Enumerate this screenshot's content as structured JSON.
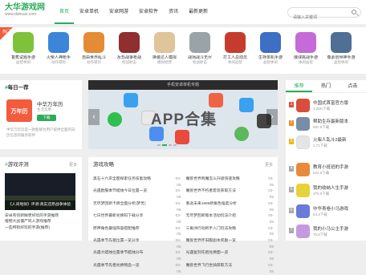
{
  "header": {
    "logo_title": "大华游戏网",
    "logo_url": "www.dahuax.com",
    "search_placeholder": "请输入关键词"
  },
  "nav": [
    "首页",
    "安卓单机",
    "安卓网游",
    "安卓软件",
    "资讯",
    "最新更新"
  ],
  "hot_tag": "热门",
  "apps": [
    {
      "name": "香蕉试题手游",
      "dl": "益智休闲",
      "color": "#7ec23a"
    },
    {
      "name": "火柴人神枪手",
      "dl": "动作冒险",
      "color": "#3b86d8"
    },
    {
      "name": "自由世界乱斗",
      "dl": "动作冒险",
      "color": "#e58b34"
    },
    {
      "name": "反恐战争枪战",
      "dl": "枪战射击",
      "color": "#8f2f2f"
    },
    {
      "name": "换装达人模拟",
      "dl": "模拟经营",
      "color": "#e0c49a"
    },
    {
      "name": "战场战斗无尽",
      "dl": "枪战射击",
      "color": "#9aa3a8"
    },
    {
      "name": "打工人总动员",
      "dl": "休闲益智",
      "color": "#c53c2d"
    },
    {
      "name": "生存单机手游",
      "dl": "益智休闲",
      "color": "#3d6fc4"
    },
    {
      "name": "爆球挑战手游",
      "dl": "休闲益智",
      "color": "#c46bd8"
    },
    {
      "name": "像素创世神手游",
      "dl": "益智休闲",
      "color": "#4f6f95"
    }
  ],
  "today": {
    "title_accent": "#",
    "title": "每日一荐",
    "app_name": "中华万年历",
    "app_char": "万年历",
    "category": "生活实用",
    "button": "下载",
    "desc": "中华万年历是一款能够为用户提供全面的日历信息的服务软件"
  },
  "banner": {
    "top": "手机安卓单机专题",
    "main": "APP合集"
  },
  "guides": {
    "title": "游戏攻略",
    "more": "更多",
    "left": [
      {
        "t": "黑石十六声全图探索任务技能攻略",
        "d": "03-05"
      },
      {
        "t": "光遇欧服季节蜡烛今日位置一览",
        "d": "03-05"
      },
      {
        "t": "无尽梦回新卡牌全面分析(梦灵)",
        "d": "03-05"
      },
      {
        "t": "七日世界最新兑换码下载分享",
        "d": "03-05"
      },
      {
        "t": "原神角色最强阵容搭配推荐",
        "d": "03-05"
      },
      {
        "t": "光遇季节先祖位置一览分享",
        "d": "03-05"
      },
      {
        "t": "光遇大蜡烛位置季节蜡烛分布",
        "d": "03-05"
      },
      {
        "t": "光遇季节先祖兑换物品一览",
        "d": "03-05"
      }
    ],
    "right": [
      {
        "t": "魔兽世界附魔怎么升级快速攻略",
        "d": "03-05"
      },
      {
        "t": "魔兽世界不朽者套装获取方法",
        "d": "03-05"
      },
      {
        "t": "重返未来1999新角色强度分析",
        "d": "03-05"
      },
      {
        "t": "无尽梦回新版本活动玩法介绍",
        "d": "03-05"
      },
      {
        "t": "三角洲行动新手入门玩法攻略",
        "d": "03-05"
      },
      {
        "t": "魔兽世界怀旧服副本奖励一览",
        "d": "03-05"
      },
      {
        "t": "光遇复刻先祖兑换图一览",
        "d": "03-05"
      },
      {
        "t": "魔兽世界飞行坐骑获取方法",
        "d": "03-05"
      }
    ]
  },
  "review": {
    "title_accent": "#",
    "title": "游戏评测",
    "more": "更多",
    "caption": "《人间地狱》评测:真实还原战争体验",
    "items": [
      "安卓有何新鲜更好玩的手游推荐",
      "植物大战僵尸同人游戏推荐",
      "一些特别好玩的手游(推荐)"
    ]
  },
  "rank": {
    "tabs": [
      "推荐",
      "热门",
      "点击"
    ],
    "items": [
      {
        "name": "中国式首富官方版",
        "dl": "1.28G下载",
        "color": "#d94d3c",
        "numc": "#e84b3c"
      },
      {
        "name": "帮助生存最新版本",
        "dl": "697.5下载",
        "color": "#7a8da6",
        "numc": "#f08a24"
      },
      {
        "name": "火柴人乱斗2最新",
        "dl": "1.71下载",
        "color": "#e5e5e5",
        "numc": "#f2b41c"
      },
      {
        "name": "教育小班班的手游",
        "dl": "522.8下载",
        "color": "#e88a3a",
        "numc": "#aaaaaa"
      },
      {
        "name": "我的收纳人生手游",
        "dl": "375.8下载",
        "color": "#e8d23a",
        "numc": "#aaaaaa"
      },
      {
        "name": "中华青卷小马游戏",
        "dl": "54.3下载",
        "color": "#6a7ad8",
        "numc": "#aaaaaa"
      },
      {
        "name": "我的小马公主手游",
        "dl": "75.8下载",
        "color": "#c39ae0",
        "numc": "#aaaaaa"
      }
    ]
  }
}
